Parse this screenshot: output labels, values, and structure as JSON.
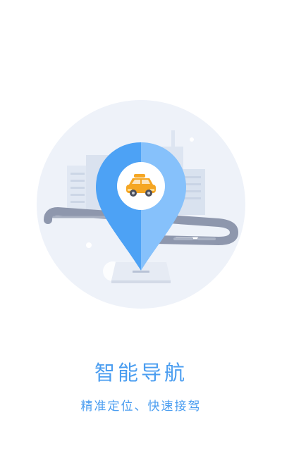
{
  "splash": {
    "title": "智能导航",
    "subtitle": "精准定位、快速接驾"
  },
  "illustration": {
    "icons": [
      "map-pin-icon",
      "taxi-car-icon"
    ],
    "colors": {
      "pin_left": "#4da2f5",
      "pin_right": "#86c1fb",
      "background_circle": "#eef2f9",
      "road": "#8e97ad",
      "buildings": "#dfe6f2",
      "car_body": "#f5a623",
      "text": "#4a9df0"
    }
  }
}
